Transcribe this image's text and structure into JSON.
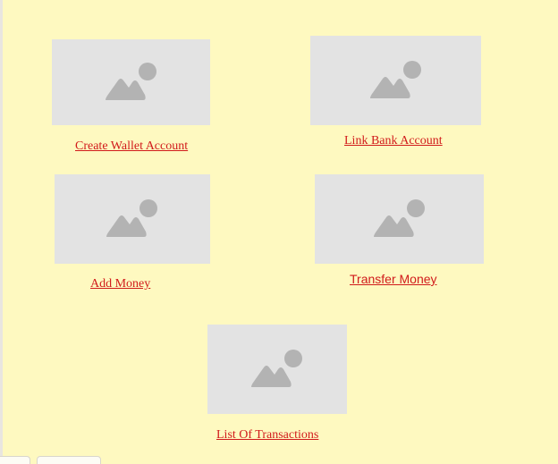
{
  "colors": {
    "background": "#fef9c0",
    "placeholder": "#e3e3e3",
    "placeholder_icon": "#b3b3b3",
    "link": "#d11b1b"
  },
  "tiles": [
    {
      "label": "Create Wallet Account",
      "icon": "image-placeholder-icon"
    },
    {
      "label": "Link Bank Account",
      "icon": "image-placeholder-icon"
    },
    {
      "label": "Add Money",
      "icon": "image-placeholder-icon"
    },
    {
      "label": "Transfer Money",
      "icon": "image-placeholder-icon"
    },
    {
      "label": "List Of Transactions",
      "icon": "image-placeholder-icon"
    }
  ]
}
